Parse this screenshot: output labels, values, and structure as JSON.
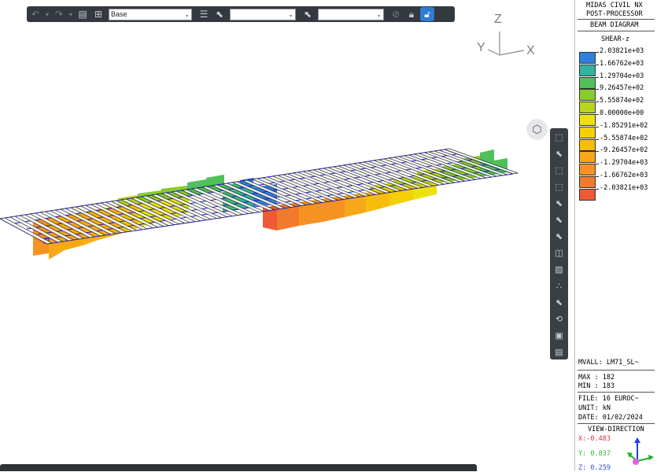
{
  "toolbar": {
    "view_select": "Base",
    "select2": "",
    "select3": ""
  },
  "axes": {
    "z": "Z",
    "y": "Y",
    "x": "X"
  },
  "panel": {
    "title1": "MIDAS CIVIL NX",
    "title2": "POST-PROCESSOR",
    "diagram": "BEAM DIAGRAM",
    "component": "SHEAR-z",
    "legend": [
      {
        "label": "2.03821e+03",
        "color": "#2f7fe0"
      },
      {
        "label": "1.66762e+03",
        "color": "#2fb4a0"
      },
      {
        "label": "1.29704e+03",
        "color": "#4fc05a"
      },
      {
        "label": "9.26457e+02",
        "color": "#86cc2c"
      },
      {
        "label": "5.55874e+02",
        "color": "#b8d41c"
      },
      {
        "label": "0.00000e+00",
        "color": "#eee00c"
      },
      {
        "label": "-1.85291e+02",
        "color": "#f5cf0a"
      },
      {
        "label": "-5.55874e+02",
        "color": "#f7bd0a"
      },
      {
        "label": "-9.26457e+02",
        "color": "#f7a818"
      },
      {
        "label": "-1.29704e+03",
        "color": "#f59222"
      },
      {
        "label": "-1.66762e+03",
        "color": "#f27a2c"
      },
      {
        "label": "-2.03821e+03",
        "color": "#ee5a36"
      }
    ],
    "mvall": "MVALL: LM71_SL~",
    "max": "MAX : 182",
    "min": "MIN : 183",
    "file": "FILE: 16 EUROC~",
    "unit": "UNIT: kN",
    "date": "DATE: 01/02/2024",
    "view_direction": "VIEW-DIRECTION",
    "vx": "X:-0.483",
    "vy": "Y: 0.837",
    "vz": "Z: 0.259",
    "vx_color": "#e03030",
    "vy_color": "#2fb82f",
    "vz_color": "#3050e0"
  }
}
